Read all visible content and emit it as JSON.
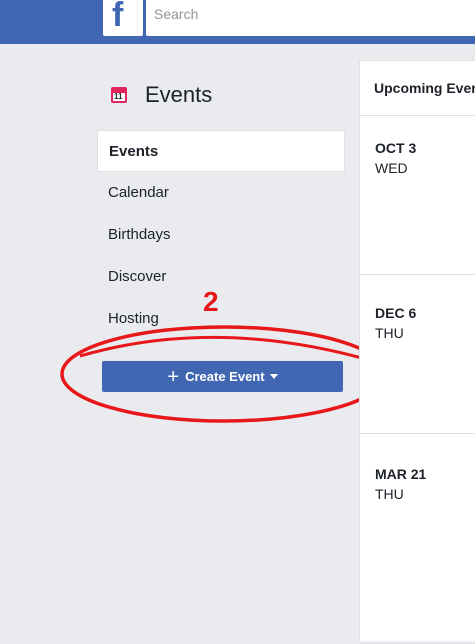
{
  "topbar": {
    "logo": "f",
    "search_placeholder": "Search"
  },
  "sidebar": {
    "title": "Events",
    "calendar_icon_number": "11",
    "items": [
      {
        "label": "Events",
        "active": true
      },
      {
        "label": "Calendar"
      },
      {
        "label": "Birthdays"
      },
      {
        "label": "Discover"
      },
      {
        "label": "Hosting"
      }
    ],
    "create_button_label": "Create Event",
    "create_button_plus": "+"
  },
  "annotation": {
    "number": "2",
    "color": "#e8181a"
  },
  "upcoming": {
    "header": "Upcoming Events",
    "events": [
      {
        "date": "OCT 3",
        "day": "WED"
      },
      {
        "date": "DEC 6",
        "day": "THU"
      },
      {
        "date": "MAR 21",
        "day": "THU"
      }
    ]
  },
  "colors": {
    "brand_blue": "#4267b2",
    "background": "#e9ebee",
    "calendar_red": "#e0245e"
  }
}
